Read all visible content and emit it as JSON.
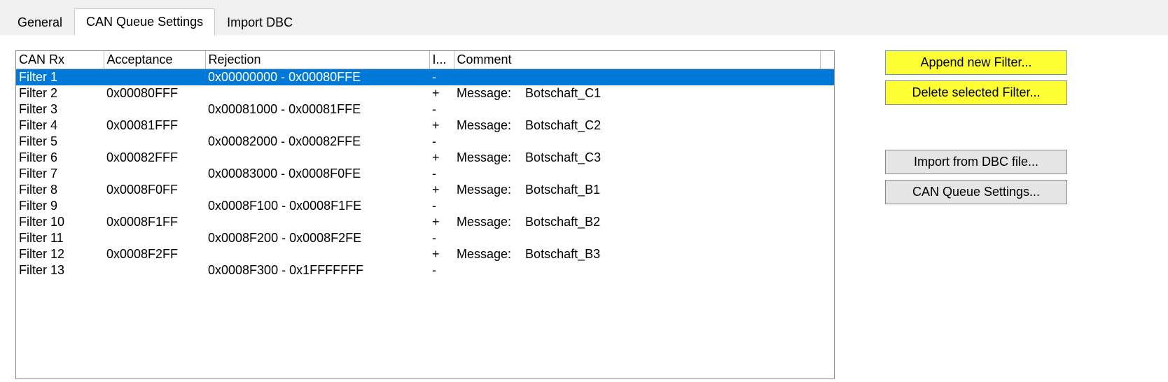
{
  "tabs": {
    "general": "General",
    "can_queue": "CAN Queue Settings",
    "import_dbc": "Import DBC"
  },
  "headers": {
    "canrx": "CAN Rx",
    "acceptance": "Acceptance",
    "rejection": "Rejection",
    "i": "I...",
    "comment": "Comment"
  },
  "rows": [
    {
      "name": "Filter 1",
      "acceptance": "",
      "rejection": "0x00000000 - 0x00080FFE",
      "i": "-",
      "msg": "",
      "detail": "",
      "selected": true
    },
    {
      "name": "Filter 2",
      "acceptance": "0x00080FFF",
      "rejection": "",
      "i": "+",
      "msg": "Message:",
      "detail": "Botschaft_C1",
      "selected": false
    },
    {
      "name": "Filter 3",
      "acceptance": "",
      "rejection": "0x00081000 - 0x00081FFE",
      "i": "-",
      "msg": "",
      "detail": "",
      "selected": false
    },
    {
      "name": "Filter 4",
      "acceptance": "0x00081FFF",
      "rejection": "",
      "i": "+",
      "msg": "Message:",
      "detail": "Botschaft_C2",
      "selected": false
    },
    {
      "name": "Filter 5",
      "acceptance": "",
      "rejection": "0x00082000 - 0x00082FFE",
      "i": "-",
      "msg": "",
      "detail": "",
      "selected": false
    },
    {
      "name": "Filter 6",
      "acceptance": "0x00082FFF",
      "rejection": "",
      "i": "+",
      "msg": "Message:",
      "detail": "Botschaft_C3",
      "selected": false
    },
    {
      "name": "Filter 7",
      "acceptance": "",
      "rejection": "0x00083000 - 0x0008F0FE",
      "i": "-",
      "msg": "",
      "detail": "",
      "selected": false
    },
    {
      "name": "Filter 8",
      "acceptance": "0x0008F0FF",
      "rejection": "",
      "i": "+",
      "msg": "Message:",
      "detail": "Botschaft_B1",
      "selected": false
    },
    {
      "name": "Filter 9",
      "acceptance": "",
      "rejection": "0x0008F100 - 0x0008F1FE",
      "i": "-",
      "msg": "",
      "detail": "",
      "selected": false
    },
    {
      "name": "Filter 10",
      "acceptance": "0x0008F1FF",
      "rejection": "",
      "i": "+",
      "msg": "Message:",
      "detail": "Botschaft_B2",
      "selected": false
    },
    {
      "name": "Filter 11",
      "acceptance": "",
      "rejection": "0x0008F200 - 0x0008F2FE",
      "i": "-",
      "msg": "",
      "detail": "",
      "selected": false
    },
    {
      "name": "Filter 12",
      "acceptance": "0x0008F2FF",
      "rejection": "",
      "i": "+",
      "msg": "Message:",
      "detail": "Botschaft_B3",
      "selected": false
    },
    {
      "name": "Filter 13",
      "acceptance": "",
      "rejection": "0x0008F300 - 0x1FFFFFFF",
      "i": "-",
      "msg": "",
      "detail": "",
      "selected": false
    }
  ],
  "buttons": {
    "append": "Append new Filter...",
    "delete": "Delete selected Filter...",
    "import": "Import from DBC file...",
    "settings": "CAN Queue Settings..."
  }
}
